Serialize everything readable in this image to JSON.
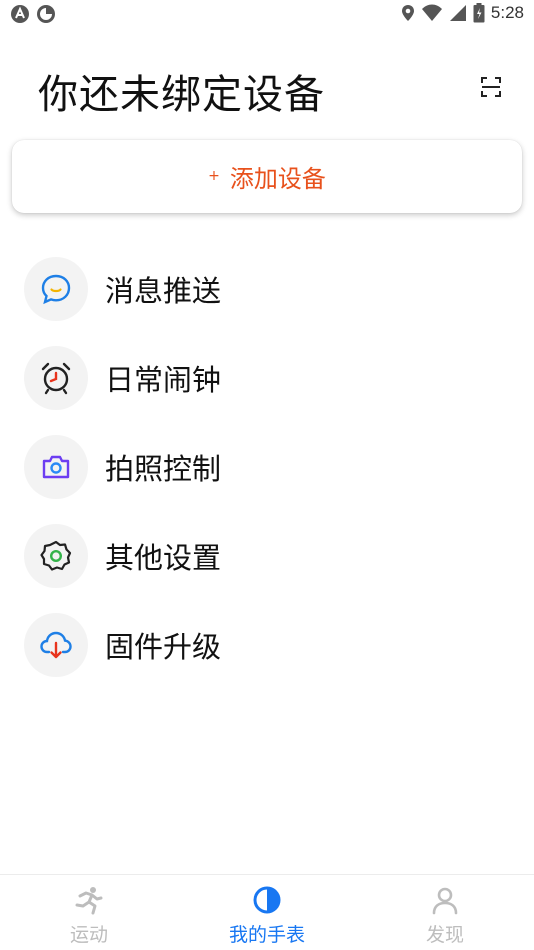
{
  "status_bar": {
    "time": "5:28"
  },
  "header": {
    "title": "你还未绑定设备"
  },
  "add_device": {
    "plus": "+",
    "label": "添加设备"
  },
  "menu": [
    {
      "label": "消息推送",
      "icon": "message-icon"
    },
    {
      "label": "日常闹钟",
      "icon": "alarm-icon"
    },
    {
      "label": "拍照控制",
      "icon": "camera-icon"
    },
    {
      "label": "其他设置",
      "icon": "gear-icon"
    },
    {
      "label": "固件升级",
      "icon": "cloud-download-icon"
    }
  ],
  "bottom_nav": [
    {
      "label": "运动",
      "active": false
    },
    {
      "label": "我的手表",
      "active": true
    },
    {
      "label": "发现",
      "active": false
    }
  ],
  "colors": {
    "accent": "#1877f2",
    "add_device": "#e8511c",
    "inactive": "#bdbdbd"
  }
}
